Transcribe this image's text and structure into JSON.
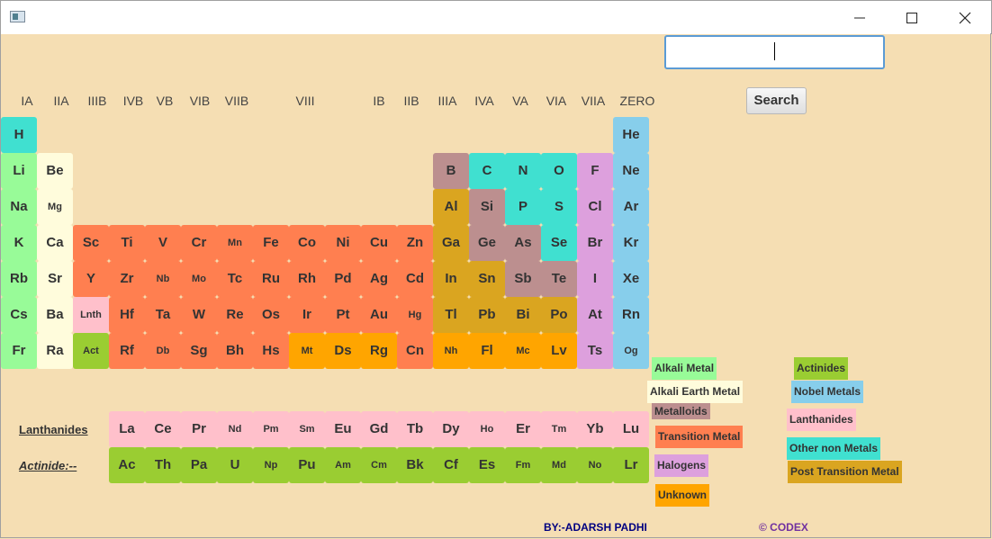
{
  "window": {
    "title": ""
  },
  "search": {
    "value": "",
    "button_label": "Search"
  },
  "group_headers": [
    "IA",
    "IIA",
    "IIIB",
    "IVB",
    "VB",
    "VIB",
    "VIIB",
    "VIII",
    "IB",
    "IIB",
    "IIIA",
    "IVA",
    "VA",
    "VIA",
    "VIIA",
    "ZERO"
  ],
  "colors": {
    "alkali_metal": "#98fb98",
    "alkali_earth_metal": "#fffcdc",
    "metalloids": "#bc8f8f",
    "transition_metal": "#ff7f50",
    "halogens": "#dda0dd",
    "unknown": "#ffa500",
    "actinides": "#9acd32",
    "nobel_metals": "#87ceeb",
    "lanthanides": "#ffc0cb",
    "other_non_metals": "#40e0d0",
    "post_transition_metal": "#daa520"
  },
  "table": {
    "rows": [
      [
        [
          "H",
          "other_non_metals"
        ],
        null,
        null,
        null,
        null,
        null,
        null,
        null,
        null,
        null,
        null,
        null,
        null,
        null,
        null,
        null,
        null,
        [
          "He",
          "nobel_metals"
        ]
      ],
      [
        [
          "Li",
          "alkali_metal"
        ],
        [
          "Be",
          "alkali_earth_metal"
        ],
        null,
        null,
        null,
        null,
        null,
        null,
        null,
        null,
        null,
        null,
        [
          "B",
          "metalloids"
        ],
        [
          "C",
          "other_non_metals"
        ],
        [
          "N",
          "other_non_metals"
        ],
        [
          "O",
          "other_non_metals"
        ],
        [
          "F",
          "halogens"
        ],
        [
          "Ne",
          "nobel_metals"
        ]
      ],
      [
        [
          "Na",
          "alkali_metal"
        ],
        [
          "Mg",
          "alkali_earth_metal"
        ],
        null,
        null,
        null,
        null,
        null,
        null,
        null,
        null,
        null,
        null,
        [
          "Al",
          "post_transition_metal"
        ],
        [
          "Si",
          "metalloids"
        ],
        [
          "P",
          "other_non_metals"
        ],
        [
          "S",
          "other_non_metals"
        ],
        [
          "Cl",
          "halogens"
        ],
        [
          "Ar",
          "nobel_metals"
        ]
      ],
      [
        [
          "K",
          "alkali_metal"
        ],
        [
          "Ca",
          "alkali_earth_metal"
        ],
        [
          "Sc",
          "transition_metal"
        ],
        [
          "Ti",
          "transition_metal"
        ],
        [
          "V",
          "transition_metal"
        ],
        [
          "Cr",
          "transition_metal"
        ],
        [
          "Mn",
          "transition_metal"
        ],
        [
          "Fe",
          "transition_metal"
        ],
        [
          "Co",
          "transition_metal"
        ],
        [
          "Ni",
          "transition_metal"
        ],
        [
          "Cu",
          "transition_metal"
        ],
        [
          "Zn",
          "transition_metal"
        ],
        [
          "Ga",
          "post_transition_metal"
        ],
        [
          "Ge",
          "metalloids"
        ],
        [
          "As",
          "metalloids"
        ],
        [
          "Se",
          "other_non_metals"
        ],
        [
          "Br",
          "halogens"
        ],
        [
          "Kr",
          "nobel_metals"
        ]
      ],
      [
        [
          "Rb",
          "alkali_metal"
        ],
        [
          "Sr",
          "alkali_earth_metal"
        ],
        [
          "Y",
          "transition_metal"
        ],
        [
          "Zr",
          "transition_metal"
        ],
        [
          "Nb",
          "transition_metal"
        ],
        [
          "Mo",
          "transition_metal"
        ],
        [
          "Tc",
          "transition_metal"
        ],
        [
          "Ru",
          "transition_metal"
        ],
        [
          "Rh",
          "transition_metal"
        ],
        [
          "Pd",
          "transition_metal"
        ],
        [
          "Ag",
          "transition_metal"
        ],
        [
          "Cd",
          "transition_metal"
        ],
        [
          "In",
          "post_transition_metal"
        ],
        [
          "Sn",
          "post_transition_metal"
        ],
        [
          "Sb",
          "metalloids"
        ],
        [
          "Te",
          "metalloids"
        ],
        [
          "I",
          "halogens"
        ],
        [
          "Xe",
          "nobel_metals"
        ]
      ],
      [
        [
          "Cs",
          "alkali_metal"
        ],
        [
          "Ba",
          "alkali_earth_metal"
        ],
        [
          "Lnth",
          "lanthanides"
        ],
        [
          "Hf",
          "transition_metal"
        ],
        [
          "Ta",
          "transition_metal"
        ],
        [
          "W",
          "transition_metal"
        ],
        [
          "Re",
          "transition_metal"
        ],
        [
          "Os",
          "transition_metal"
        ],
        [
          "Ir",
          "transition_metal"
        ],
        [
          "Pt",
          "transition_metal"
        ],
        [
          "Au",
          "transition_metal"
        ],
        [
          "Hg",
          "transition_metal"
        ],
        [
          "Tl",
          "post_transition_metal"
        ],
        [
          "Pb",
          "post_transition_metal"
        ],
        [
          "Bi",
          "post_transition_metal"
        ],
        [
          "Po",
          "post_transition_metal"
        ],
        [
          "At",
          "halogens"
        ],
        [
          "Rn",
          "nobel_metals"
        ]
      ],
      [
        [
          "Fr",
          "alkali_metal"
        ],
        [
          "Ra",
          "alkali_earth_metal"
        ],
        [
          "Act",
          "actinides"
        ],
        [
          "Rf",
          "transition_metal"
        ],
        [
          "Db",
          "transition_metal"
        ],
        [
          "Sg",
          "transition_metal"
        ],
        [
          "Bh",
          "transition_metal"
        ],
        [
          "Hs",
          "transition_metal"
        ],
        [
          "Mt",
          "unknown"
        ],
        [
          "Ds",
          "unknown"
        ],
        [
          "Rg",
          "unknown"
        ],
        [
          "Cn",
          "transition_metal"
        ],
        [
          "Nh",
          "unknown"
        ],
        [
          "Fl",
          "unknown"
        ],
        [
          "Mc",
          "unknown"
        ],
        [
          "Lv",
          "unknown"
        ],
        [
          "Ts",
          "halogens"
        ],
        [
          "Og",
          "nobel_metals"
        ]
      ]
    ]
  },
  "lanthanides": {
    "label": "Lanthanides",
    "elements": [
      "La",
      "Ce",
      "Pr",
      "Nd",
      "Pm",
      "Sm",
      "Eu",
      "Gd",
      "Tb",
      "Dy",
      "Ho",
      "Er",
      "Tm",
      "Yb",
      "Lu"
    ]
  },
  "actinides": {
    "label": "Actinide:--",
    "elements": [
      "Ac",
      "Th",
      "Pa",
      "U",
      "Np",
      "Pu",
      "Am",
      "Cm",
      "Bk",
      "Cf",
      "Es",
      "Fm",
      "Md",
      "No",
      "Lr"
    ]
  },
  "legend": [
    {
      "label": "Alkali Metal",
      "category": "alkali_metal"
    },
    {
      "label": "Alkali Earth Metal",
      "category": "alkali_earth_metal"
    },
    {
      "label": "Metalloids",
      "category": "metalloids"
    },
    {
      "label": "Transition Metal",
      "category": "transition_metal"
    },
    {
      "label": "Halogens",
      "category": "halogens"
    },
    {
      "label": "Unknown",
      "category": "unknown"
    },
    {
      "label": "Actinides",
      "category": "actinides"
    },
    {
      "label": "Nobel Metals",
      "category": "nobel_metals"
    },
    {
      "label": "Lanthanides",
      "category": "lanthanides"
    },
    {
      "label": "Other non Metals",
      "category": "other_non_metals"
    },
    {
      "label": "Post Transition Metal",
      "category": "post_transition_metal"
    }
  ],
  "footer": {
    "author": "BY:-ADARSH PADHI",
    "copyright": "© CODEX"
  }
}
